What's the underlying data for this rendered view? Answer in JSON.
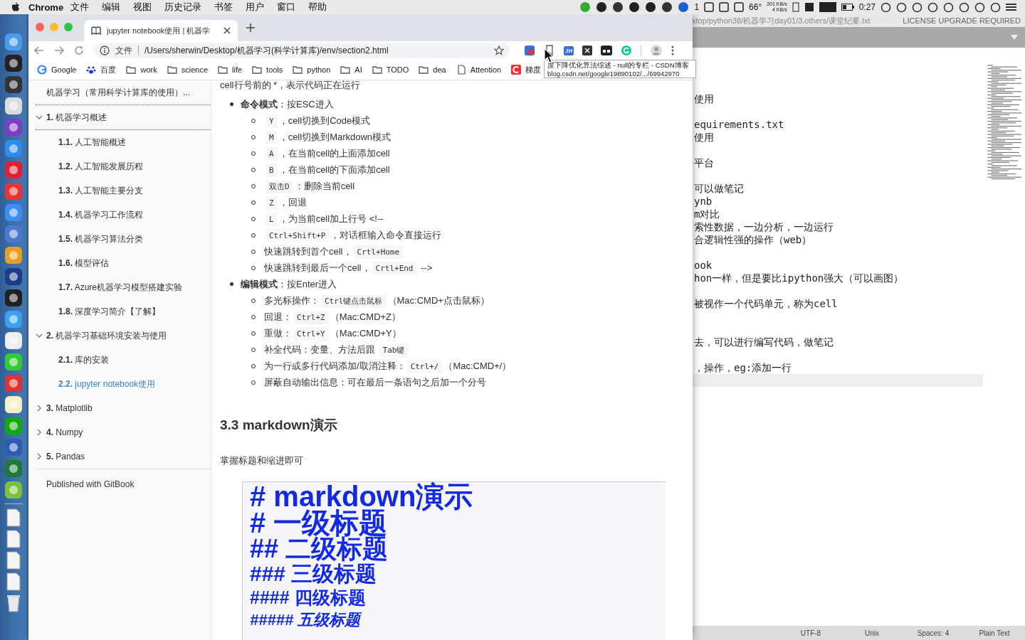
{
  "menubar": {
    "app": "Chrome",
    "menus": [
      "文件",
      "编辑",
      "视图",
      "历史记录",
      "书签",
      "用户",
      "窗口",
      "帮助"
    ],
    "status": [
      {
        "kind": "badge",
        "text": "1"
      },
      {
        "kind": "temp",
        "text": "66°"
      },
      {
        "kind": "net",
        "up": "201 KB/s",
        "down": "4 KB/s"
      },
      {
        "kind": "battery",
        "text": "0:27"
      }
    ]
  },
  "browser": {
    "tab": {
      "title": "jupyter notebook使用 | 机器学"
    },
    "address": {
      "scheme": "文件",
      "url": "/Users/sherwin/Desktop/机器学习(科学计算库)/env/section2.html"
    },
    "extension_label": "JH",
    "bookmarks": [
      {
        "kind": "google",
        "label": "Google"
      },
      {
        "kind": "paw",
        "label": "百度"
      },
      {
        "kind": "folder",
        "label": "work"
      },
      {
        "kind": "folder",
        "label": "science"
      },
      {
        "kind": "folder",
        "label": "life"
      },
      {
        "kind": "folder",
        "label": "tools"
      },
      {
        "kind": "folder",
        "label": "python"
      },
      {
        "kind": "folder",
        "label": "AI"
      },
      {
        "kind": "folder",
        "label": "TODO"
      },
      {
        "kind": "folder",
        "label": "dea"
      },
      {
        "kind": "page",
        "label": "Attention"
      },
      {
        "kind": "csdn",
        "label": "梯度"
      }
    ],
    "tooltip": [
      "度下降优化算法综述 - null的专栏 - CSDN博客",
      "blog.csdn.net/google19890102/.../69942970"
    ]
  },
  "sidebar": {
    "header": "机器学习（常用科学计算库的使用）...",
    "items": [
      {
        "num": "1.",
        "label": "机器学习概述",
        "expanded": true,
        "selected": false,
        "children": [
          {
            "num": "1.1.",
            "label": "人工智能概述",
            "selected": false
          },
          {
            "num": "1.2.",
            "label": "人工智能发展历程",
            "selected": false
          },
          {
            "num": "1.3.",
            "label": "人工智能主要分支",
            "selected": false
          },
          {
            "num": "1.4.",
            "label": "机器学习工作流程",
            "selected": false
          },
          {
            "num": "1.5.",
            "label": "机器学习算法分类",
            "selected": false
          },
          {
            "num": "1.6.",
            "label": "模型评估",
            "selected": false
          },
          {
            "num": "1.7.",
            "label": "Azure机器学习模型搭建实验",
            "selected": false
          },
          {
            "num": "1.8.",
            "label": "深度学习简介【了解】",
            "selected": false
          }
        ]
      },
      {
        "num": "2.",
        "label": "机器学习基础环境安装与使用",
        "expanded": true,
        "selected": false,
        "children": [
          {
            "num": "2.1.",
            "label": "库的安装",
            "selected": false
          },
          {
            "num": "2.2.",
            "label": "jupyter notebook使用",
            "selected": true
          }
        ]
      },
      {
        "num": "3.",
        "label": "Matplotlib",
        "expanded": false,
        "selected": false
      },
      {
        "num": "4.",
        "label": "Numpy",
        "expanded": false,
        "selected": false
      },
      {
        "num": "5.",
        "label": "Pandas",
        "expanded": false,
        "selected": false
      }
    ],
    "footer": "Published with GitBook"
  },
  "content": {
    "intro": "cell行号前的 *，表示代码正在运行",
    "list": [
      {
        "parts": [
          {
            "kind": "bold",
            "text": "命令模式"
          },
          {
            "kind": "plain",
            "text": "：按ESC进入"
          }
        ],
        "children": [
          [
            {
              "kind": "code",
              "text": "Y"
            },
            {
              "kind": "plain",
              "text": "，cell切换到Code模式"
            }
          ],
          [
            {
              "kind": "code",
              "text": "M"
            },
            {
              "kind": "plain",
              "text": "，cell切换到Markdown模式"
            }
          ],
          [
            {
              "kind": "code",
              "text": "A"
            },
            {
              "kind": "plain",
              "text": "，在当前cell的上面添加cell"
            }
          ],
          [
            {
              "kind": "code",
              "text": "B"
            },
            {
              "kind": "plain",
              "text": "，在当前cell的下面添加cell"
            }
          ],
          [
            {
              "kind": "code",
              "text": "双击D"
            },
            {
              "kind": "plain",
              "text": "：删除当前cell"
            }
          ],
          [
            {
              "kind": "code",
              "text": "Z"
            },
            {
              "kind": "plain",
              "text": "，回退"
            }
          ],
          [
            {
              "kind": "code",
              "text": "L"
            },
            {
              "kind": "plain",
              "text": "，为当前cell加上行号 <!--"
            }
          ],
          [
            {
              "kind": "code",
              "text": "Ctrl+Shift+P"
            },
            {
              "kind": "plain",
              "text": "，对话框输入命令直接运行"
            }
          ],
          [
            {
              "kind": "plain",
              "text": "快速跳转到首个cell，"
            },
            {
              "kind": "code",
              "text": "Crtl+Home"
            }
          ],
          [
            {
              "kind": "plain",
              "text": "快速跳转到最后一个cell，"
            },
            {
              "kind": "code",
              "text": "Crtl+End"
            },
            {
              "kind": "plain",
              "text": " -->"
            }
          ]
        ]
      },
      {
        "parts": [
          {
            "kind": "bold",
            "text": "编辑模式"
          },
          {
            "kind": "plain",
            "text": "：按Enter进入"
          }
        ],
        "children": [
          [
            {
              "kind": "plain",
              "text": "多光标操作："
            },
            {
              "kind": "code",
              "text": "Ctrl键点击鼠标"
            },
            {
              "kind": "plain",
              "text": "（Mac:CMD+点击鼠标）"
            }
          ],
          [
            {
              "kind": "plain",
              "text": "回退："
            },
            {
              "kind": "code",
              "text": "Ctrl+Z"
            },
            {
              "kind": "plain",
              "text": "（Mac:CMD+Z）"
            }
          ],
          [
            {
              "kind": "plain",
              "text": "重做："
            },
            {
              "kind": "code",
              "text": "Ctrl+Y"
            },
            {
              "kind": "plain",
              "text": "（Mac:CMD+Y）"
            }
          ],
          [
            {
              "kind": "plain",
              "text": "补全代码：变量、方法后跟 "
            },
            {
              "kind": "code",
              "text": "Tab键"
            }
          ],
          [
            {
              "kind": "plain",
              "text": "为一行或多行代码添加/取消注释："
            },
            {
              "kind": "code",
              "text": "Ctrl+/"
            },
            {
              "kind": "plain",
              "text": "（Mac:CMD+/）"
            }
          ],
          [
            {
              "kind": "plain",
              "text": "屏蔽自动输出信息：可在最后一条语句之后加一个分号"
            }
          ]
        ]
      }
    ],
    "heading": "3.3 markdown演示",
    "paragraph": "掌握标题和缩进即可",
    "demo": [
      {
        "kind": "h1",
        "text": "# markdown演示"
      },
      {
        "kind": "h1",
        "text": "# 一级标题"
      },
      {
        "kind": "h2",
        "text": "## 二级标题"
      },
      {
        "kind": "h3",
        "text": "### 三级标题"
      },
      {
        "kind": "h4",
        "text": "#### 四级标题"
      },
      {
        "kind": "h5",
        "text": "##### 五级标题"
      }
    ]
  },
  "editor": {
    "title": "ktop/python38/机器学习day01/3.others/课堂纪要.txt",
    "license": "LICENSE UPGRADE REQUIRED",
    "blocks": [
      [
        "使用"
      ],
      [
        "equirements.txt",
        "使用"
      ],
      [
        "平台"
      ],
      [
        "可以做笔记",
        "ynb",
        "m对比",
        "索性数据，一边分析，一边运行",
        "合逻辑性强的操作（web）"
      ],
      [
        "ook",
        "hon一样，但是要比ipython强大（可以画图）"
      ],
      [
        "被视作一个代码单元，称为cell"
      ],
      [
        "去，可以进行编写代码，做笔记"
      ],
      [
        "，操作，eg:添加一行"
      ]
    ],
    "status": [
      "UTF-8",
      "Unix",
      "Spaces: 4",
      "Plain Text"
    ]
  }
}
